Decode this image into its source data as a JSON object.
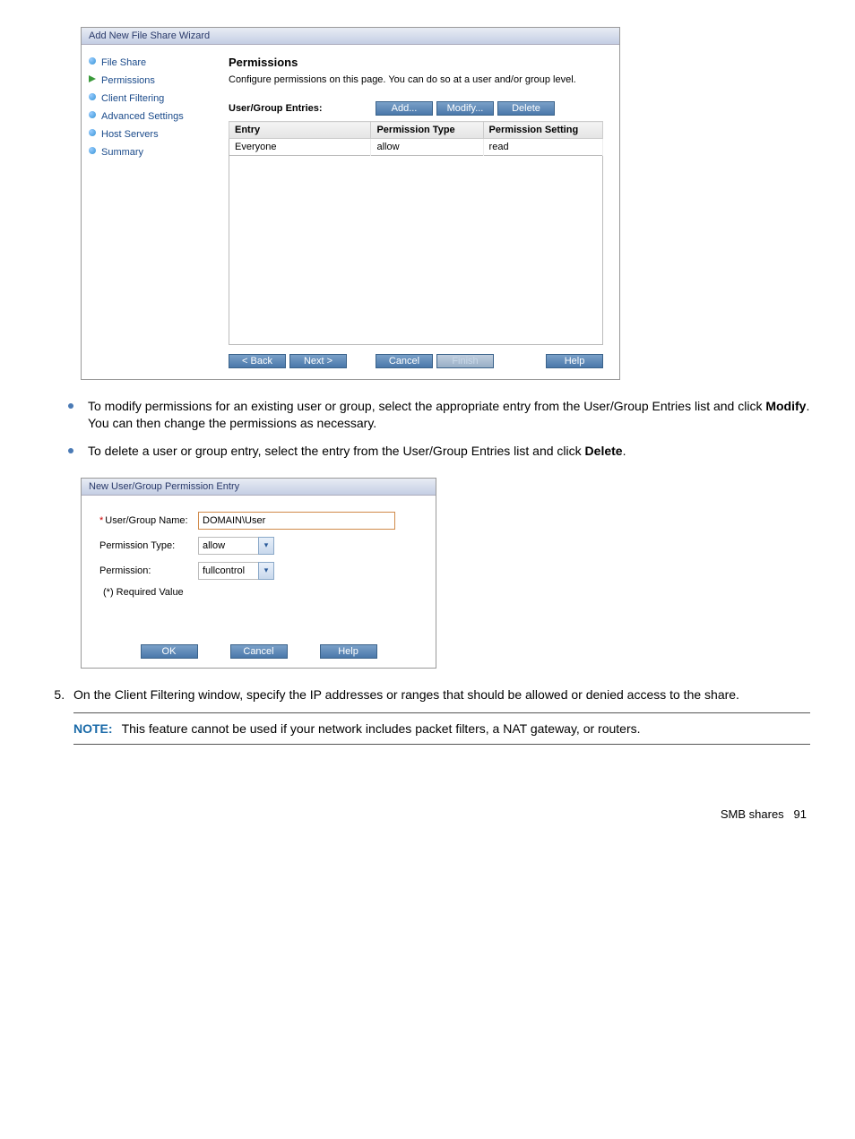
{
  "wizard1": {
    "title": "Add New File Share Wizard",
    "sidebar": {
      "items": [
        {
          "label": "File Share",
          "active": false
        },
        {
          "label": "Permissions",
          "active": true
        },
        {
          "label": "Client Filtering",
          "active": false
        },
        {
          "label": "Advanced Settings",
          "active": false
        },
        {
          "label": "Host Servers",
          "active": false
        },
        {
          "label": "Summary",
          "active": false
        }
      ]
    },
    "heading": "Permissions",
    "description": "Configure permissions on this page. You can do so at a user and/or group level.",
    "entries_label": "User/Group Entries:",
    "buttons": {
      "add": "Add...",
      "modify": "Modify...",
      "delete": "Delete"
    },
    "table": {
      "headers": [
        "Entry",
        "Permission Type",
        "Permission Setting"
      ],
      "rows": [
        {
          "entry": "Everyone",
          "type": "allow",
          "setting": "read"
        }
      ]
    },
    "nav": {
      "back": "< Back",
      "next": "Next >",
      "cancel": "Cancel",
      "finish": "Finish",
      "help": "Help"
    }
  },
  "bullets": [
    {
      "pre": "To modify permissions for an existing user or group, select the appropriate entry from the User/Group Entries list and click ",
      "bold": "Modify",
      "post": ". You can then change the permissions as necessary."
    },
    {
      "pre": "To delete a user or group entry, select the entry from the User/Group Entries list and click ",
      "bold": "Delete",
      "post": "."
    }
  ],
  "wizard2": {
    "title": "New User/Group Permission Entry",
    "fields": {
      "usergroup_label": "User/Group Name:",
      "usergroup_value": "DOMAIN\\User",
      "permtype_label": "Permission Type:",
      "permtype_value": "allow",
      "perm_label": "Permission:",
      "perm_value": "fullcontrol"
    },
    "required_note": "(*) Required Value",
    "buttons": {
      "ok": "OK",
      "cancel": "Cancel",
      "help": "Help"
    }
  },
  "step5": {
    "num": "5.",
    "text": "On the Client Filtering window, specify the IP addresses or ranges that should be allowed or denied access to the share."
  },
  "note": {
    "label": "NOTE:",
    "text": "This feature cannot be used if your network includes packet filters, a NAT gateway, or routers."
  },
  "footer": {
    "section": "SMB shares",
    "page": "91"
  }
}
